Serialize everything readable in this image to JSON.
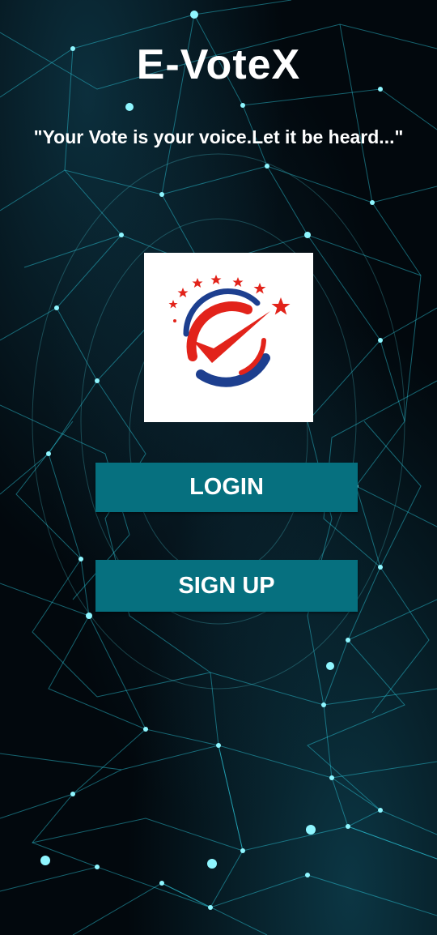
{
  "app": {
    "title": "E-VoteX",
    "tagline": "\"Your Vote is your voice.Let it be heard...\""
  },
  "logo": {
    "icon": "ballot-checkmark-logo-icon"
  },
  "actions": {
    "login_label": "LOGIN",
    "signup_label": "SIGN UP"
  },
  "colors": {
    "button": "#06707f",
    "background": "#02080d",
    "network_lines": "#2fd2e6",
    "logo_red": "#e2231a",
    "logo_blue": "#1d3f8f"
  }
}
